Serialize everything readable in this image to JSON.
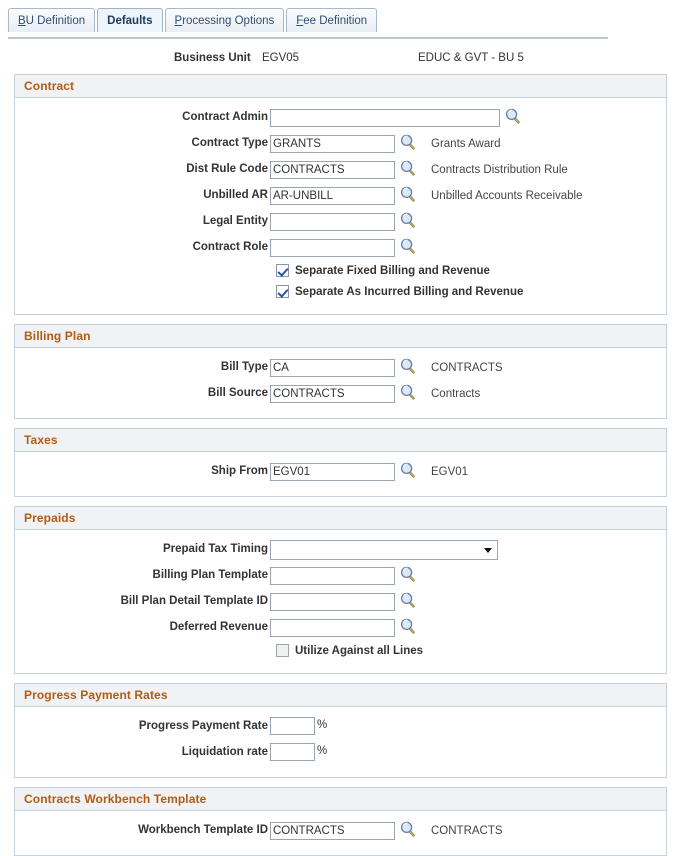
{
  "tabs": [
    {
      "label": "BU Definition",
      "accel": "B",
      "rest": "U Definition",
      "active": false
    },
    {
      "label": "Defaults",
      "accel": "D",
      "rest": "efaults",
      "active": true
    },
    {
      "label": "Processing Options",
      "accel": "P",
      "rest": "rocessing Options",
      "active": false
    },
    {
      "label": "Fee Definition",
      "accel": "F",
      "rest": "ee Definition",
      "active": false
    }
  ],
  "header": {
    "business_unit_label": "Business Unit",
    "business_unit_value": "EGV05",
    "business_unit_description": "EDUC & GVT - BU 5"
  },
  "colors": {
    "section_header_text": "#b25c12",
    "section_header_bg": "#f0f2f5",
    "panel_border": "#c8d0da",
    "tab_text": "#2f4f6f"
  },
  "icons": {
    "lookup": "magnifier-icon",
    "dropdown": "chevron-down-icon"
  },
  "sections": [
    {
      "title": "Contract",
      "fields": [
        {
          "label": "Contract Admin",
          "value": "",
          "placeholder": "",
          "width": "w230",
          "lookup": true,
          "desc": ""
        },
        {
          "label": "Contract Type",
          "value": "GRANTS",
          "placeholder": "",
          "width": "w125",
          "lookup": true,
          "desc": "Grants Award"
        },
        {
          "label": "Dist Rule Code",
          "value": "CONTRACTS",
          "placeholder": "",
          "width": "w125",
          "lookup": true,
          "desc": "Contracts Distribution Rule"
        },
        {
          "label": "Unbilled AR",
          "value": "AR-UNBILL",
          "placeholder": "",
          "width": "w125",
          "lookup": true,
          "desc": "Unbilled Accounts Receivable"
        },
        {
          "label": "Legal Entity",
          "value": "",
          "placeholder": "",
          "width": "w125",
          "lookup": true,
          "desc": ""
        },
        {
          "label": "Contract Role",
          "value": "",
          "placeholder": "",
          "width": "w125",
          "lookup": true,
          "desc": ""
        }
      ],
      "checkboxes": [
        {
          "label": "Separate Fixed Billing and Revenue",
          "checked": true
        },
        {
          "label": "Separate As Incurred Billing and Revenue",
          "checked": true
        }
      ]
    },
    {
      "title": "Billing Plan",
      "fields": [
        {
          "label": "Bill Type",
          "value": "CA",
          "placeholder": "",
          "width": "w125",
          "lookup": true,
          "desc": "CONTRACTS"
        },
        {
          "label": "Bill Source",
          "value": "CONTRACTS",
          "placeholder": "",
          "width": "w125",
          "lookup": true,
          "desc": "Contracts"
        }
      ],
      "checkboxes": []
    },
    {
      "title": "Taxes",
      "fields": [
        {
          "label": "Ship From",
          "value": "EGV01",
          "placeholder": "",
          "width": "w125",
          "lookup": true,
          "desc": "EGV01"
        }
      ],
      "checkboxes": []
    },
    {
      "title": "Prepaids",
      "fields": [
        {
          "label": "Prepaid Tax Timing",
          "value": "",
          "placeholder": "",
          "width": "ddl",
          "lookup": false,
          "desc": "",
          "type": "select",
          "options": [
            ""
          ]
        },
        {
          "label": "Billing Plan Template",
          "value": "",
          "placeholder": "",
          "width": "w125",
          "lookup": true,
          "desc": ""
        },
        {
          "label": "Bill Plan Detail Template ID",
          "value": "",
          "placeholder": "",
          "width": "w125",
          "lookup": true,
          "desc": ""
        },
        {
          "label": "Deferred Revenue",
          "value": "",
          "placeholder": "",
          "width": "w125",
          "lookup": true,
          "desc": ""
        }
      ],
      "checkboxes": [
        {
          "label": "Utilize Against all Lines",
          "checked": false
        }
      ]
    },
    {
      "title": "Progress Payment Rates",
      "fields": [
        {
          "label": "Progress Payment Rate",
          "value": "",
          "placeholder": "",
          "width": "w45",
          "lookup": false,
          "desc": "",
          "suffix": "%"
        },
        {
          "label": "Liquidation rate",
          "value": "",
          "placeholder": "",
          "width": "w45",
          "lookup": false,
          "desc": "",
          "suffix": "%"
        }
      ],
      "checkboxes": []
    },
    {
      "title": "Contracts Workbench Template",
      "fields": [
        {
          "label": "Workbench Template ID",
          "value": "CONTRACTS",
          "placeholder": "",
          "width": "w125",
          "lookup": true,
          "desc": "CONTRACTS"
        }
      ],
      "checkboxes": []
    }
  ]
}
